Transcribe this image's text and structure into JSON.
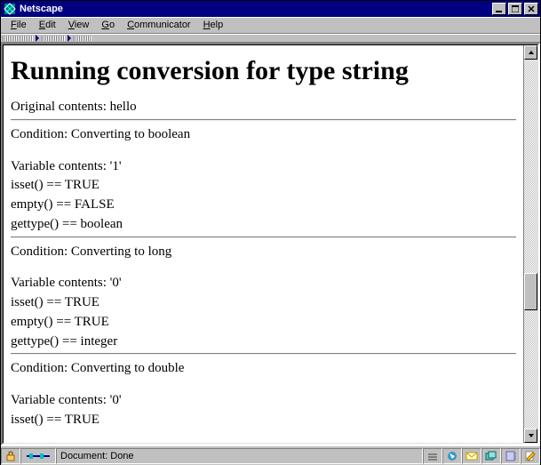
{
  "window": {
    "title": "Netscape"
  },
  "menu": {
    "file": "File",
    "edit": "Edit",
    "view": "View",
    "go": "Go",
    "communicator": "Communicator",
    "help": "Help"
  },
  "page": {
    "heading": "Running conversion for type string",
    "original": "Original contents: hello",
    "sec1": {
      "cond": "Condition: Converting to boolean",
      "var": "Variable contents: '1'",
      "isset": "isset() == TRUE",
      "empty": "empty() == FALSE",
      "gettype": "gettype() == boolean"
    },
    "sec2": {
      "cond": "Condition: Converting to long",
      "var": "Variable contents: '0'",
      "isset": "isset() == TRUE",
      "empty": "empty() == TRUE",
      "gettype": "gettype() == integer"
    },
    "sec3": {
      "cond": "Condition: Converting to double",
      "var": "Variable contents: '0'",
      "isset": "isset() == TRUE"
    }
  },
  "status": {
    "text": "Document: Done"
  }
}
